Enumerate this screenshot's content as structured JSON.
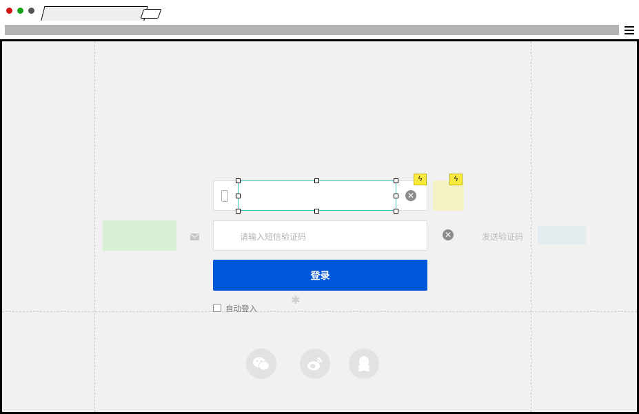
{
  "form": {
    "sms_placeholder": "请输入短信验证码",
    "send_code_label": "发送验证码",
    "clear_glyph": "✕",
    "login_label": "登录",
    "auto_login_label": "自动登入",
    "bolt_glyph": "ϟ",
    "gear_glyph": "✱"
  },
  "social": [
    {
      "name": "wechat-icon"
    },
    {
      "name": "weibo-icon"
    },
    {
      "name": "qq-icon"
    }
  ],
  "colors": {
    "primary": "#0057d9",
    "green_block": "#d8efd6",
    "yellow_block": "#f4f2c4",
    "blue_block": "#e4ecf0",
    "selection": "#2fc4c4",
    "bolt": "#f6e83c"
  }
}
